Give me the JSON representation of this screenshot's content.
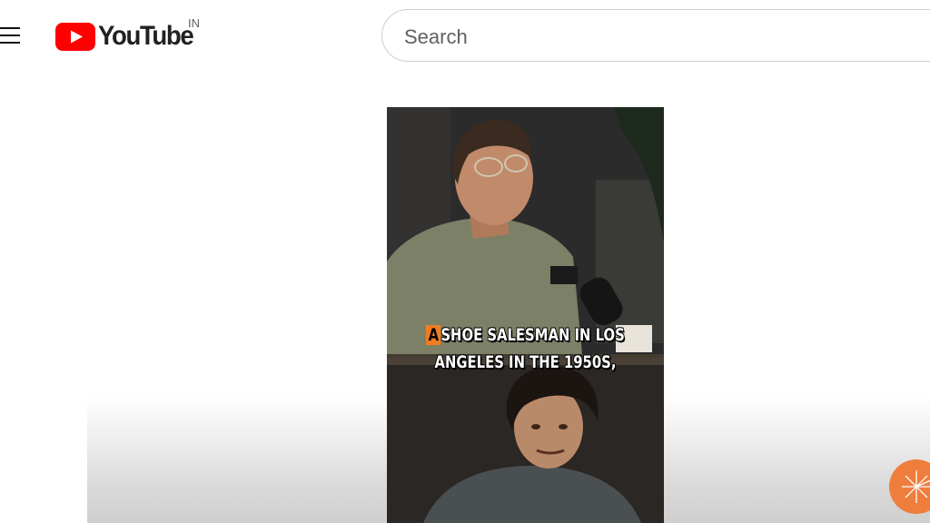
{
  "header": {
    "logo_text": "YouTube",
    "country_code": "IN",
    "search_placeholder": "Search"
  },
  "video": {
    "caption_highlight": "A",
    "caption_line1_rest": "SHOE SALESMAN IN LOS",
    "caption_line2": "ANGELES IN THE 1950S,"
  },
  "colors": {
    "brand_red": "#ff0000",
    "caption_highlight": "#f07c22",
    "action_button": "#ef7d3c"
  },
  "icons": {
    "menu": "hamburger-menu-icon",
    "logo": "youtube-play-icon",
    "action": "sparkle-icon"
  }
}
